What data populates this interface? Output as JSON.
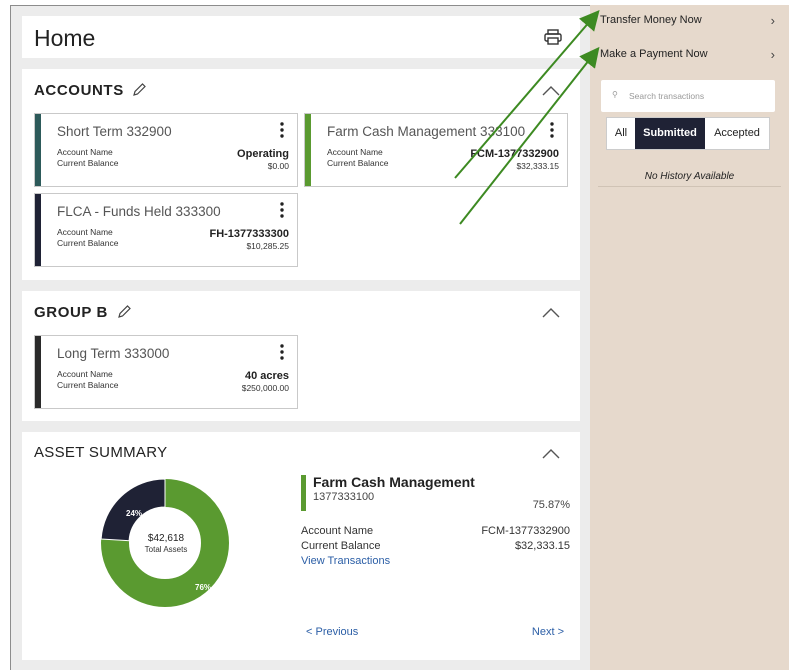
{
  "home": {
    "title": "Home"
  },
  "accounts_section": {
    "title": "ACCOUNTS",
    "accounts": [
      {
        "name": "Short Term 332900",
        "account_name_label": "Account Name",
        "account_name": "Operating",
        "balance_label": "Current Balance",
        "balance": "$0.00",
        "color": "#2d5a5a"
      },
      {
        "name": "Farm Cash Management 333100",
        "account_name_label": "Account Name",
        "account_name": "FCM-1377332900",
        "balance_label": "Current Balance",
        "balance": "$32,333.15",
        "color": "#5a9a30"
      },
      {
        "name": "FLCA - Funds Held 333300",
        "account_name_label": "Account Name",
        "account_name": "FH-1377333300",
        "balance_label": "Current Balance",
        "balance": "$10,285.25",
        "color": "#1f2235"
      }
    ]
  },
  "group_b": {
    "title": "GROUP B",
    "accounts": [
      {
        "name": "Long Term 333000",
        "account_name_label": "Account Name",
        "account_name": "40 acres",
        "balance_label": "Current Balance",
        "balance": "$250,000.00",
        "color": "#2a2a2a"
      }
    ]
  },
  "asset_summary": {
    "title": "ASSET SUMMARY",
    "donut": {
      "dark_pct": 24,
      "green_pct": 76,
      "dark_label": "24%",
      "green_label": "76%",
      "center_value": "$42,618",
      "center_label": "Total Assets",
      "dark_color": "#1f2235",
      "green_color": "#5a9a30"
    },
    "selected": {
      "name": "Farm Cash Management",
      "number": "1377333100",
      "percent": "75.87%",
      "account_name_label": "Account Name",
      "account_name": "FCM-1377332900",
      "balance_label": "Current Balance",
      "balance": "$32,333.15",
      "link": "View Transactions"
    },
    "previous": "< Previous",
    "next": "Next >"
  },
  "sidebar": {
    "transfer": "Transfer Money Now",
    "payment": "Make a Payment Now",
    "search_placeholder": "Search transactions",
    "tabs": [
      "All",
      "Submitted",
      "Accepted"
    ],
    "active_tab": "Submitted",
    "no_history": "No History Available"
  },
  "colors": {
    "accent": "#5a9a30",
    "dark": "#1f2235",
    "side_bg": "#e6d9cc",
    "link": "#2b5ea6"
  }
}
